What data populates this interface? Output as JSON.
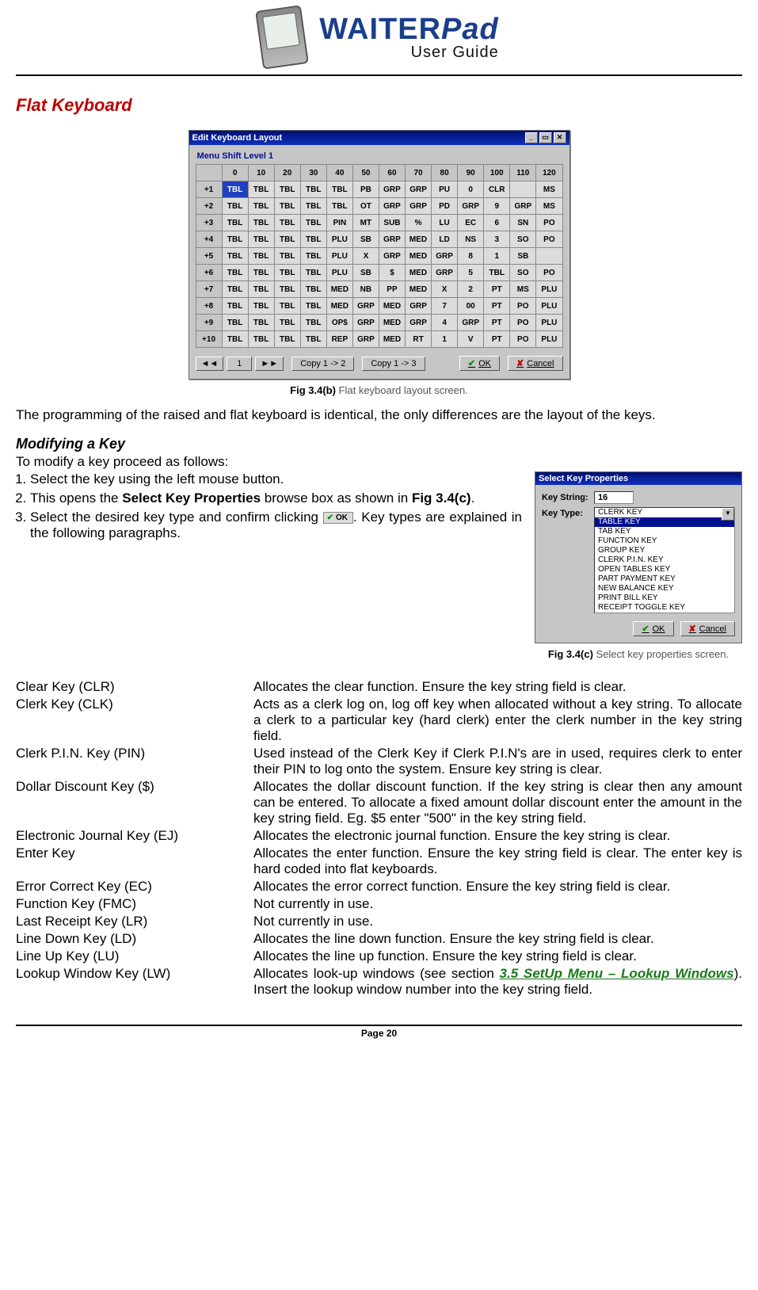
{
  "header": {
    "brand": "WAITER",
    "brand_suffix": "Pad",
    "subtitle": "User Guide"
  },
  "section_title": "Flat Keyboard",
  "kbd_window": {
    "title": "Edit Keyboard Layout",
    "shift_label": "Menu Shift Level 1",
    "col_headers": [
      "0",
      "10",
      "20",
      "30",
      "40",
      "50",
      "60",
      "70",
      "80",
      "90",
      "100",
      "110",
      "120"
    ],
    "row_headers": [
      "+1",
      "+2",
      "+3",
      "+4",
      "+5",
      "+6",
      "+7",
      "+8",
      "+9",
      "+10"
    ],
    "cells": [
      [
        "TBL",
        "TBL",
        "TBL",
        "TBL",
        "TBL",
        "PB",
        "GRP",
        "GRP",
        "PU",
        "0",
        "CLR",
        "",
        "MS"
      ],
      [
        "TBL",
        "TBL",
        "TBL",
        "TBL",
        "TBL",
        "OT",
        "GRP",
        "GRP",
        "PD",
        "GRP",
        "9",
        "GRP",
        "MS"
      ],
      [
        "TBL",
        "TBL",
        "TBL",
        "TBL",
        "PIN",
        "MT",
        "SUB",
        "%",
        "LU",
        "EC",
        "6",
        "SN",
        "PO"
      ],
      [
        "TBL",
        "TBL",
        "TBL",
        "TBL",
        "PLU",
        "SB",
        "GRP",
        "MED",
        "LD",
        "NS",
        "3",
        "SO",
        "PO"
      ],
      [
        "TBL",
        "TBL",
        "TBL",
        "TBL",
        "PLU",
        "X",
        "GRP",
        "MED",
        "GRP",
        "8",
        "1",
        "SB",
        ""
      ],
      [
        "TBL",
        "TBL",
        "TBL",
        "TBL",
        "PLU",
        "SB",
        "$",
        "MED",
        "GRP",
        "5",
        "TBL",
        "SO",
        "PO"
      ],
      [
        "TBL",
        "TBL",
        "TBL",
        "TBL",
        "MED",
        "NB",
        "PP",
        "MED",
        "X",
        "2",
        "PT",
        "MS",
        "PLU"
      ],
      [
        "TBL",
        "TBL",
        "TBL",
        "TBL",
        "MED",
        "GRP",
        "MED",
        "GRP",
        "7",
        "00",
        "PT",
        "PO",
        "PLU"
      ],
      [
        "TBL",
        "TBL",
        "TBL",
        "TBL",
        "OP$",
        "GRP",
        "MED",
        "GRP",
        "4",
        "GRP",
        "PT",
        "PO",
        "PLU"
      ],
      [
        "TBL",
        "TBL",
        "TBL",
        "TBL",
        "REP",
        "GRP",
        "MED",
        "RT",
        "1",
        "V",
        "PT",
        "PO",
        "PLU"
      ]
    ],
    "pager_value": "1",
    "copy12": "Copy 1 -> 2",
    "copy13": "Copy 1 -> 3",
    "ok": "OK",
    "cancel": "Cancel"
  },
  "fig_b_label": "Fig 3.4(b)",
  "fig_b_text": " Flat keyboard layout screen.",
  "para1": "The programming of the raised and flat keyboard is identical, the only differences are the layout of the keys.",
  "subheading": "Modifying a Key",
  "intro": "To modify a key proceed as follows:",
  "steps": {
    "s1": "Select the key using the left mouse button.",
    "s2a": "This opens the ",
    "s2b": "Select Key Properties",
    "s2c": " browse box as shown in ",
    "s2_figref": "Fig 3.4(c)",
    "s2d": ".",
    "s3a": "Select the desired key type and confirm clicking ",
    "s3_ok": "OK",
    "s3b": ". Key types are explained in the following paragraphs."
  },
  "props_window": {
    "title": "Select Key Properties",
    "keystring_label": "Key String:",
    "keystring_value": "16",
    "keytype_label": "Key Type:",
    "options": [
      "CLERK KEY",
      "TABLE KEY",
      "TAB KEY",
      "FUNCTION KEY",
      "GROUP KEY",
      "CLERK P.I.N. KEY",
      "OPEN TABLES KEY",
      "PART PAYMENT KEY",
      "NEW BALANCE KEY",
      "PRINT BILL KEY",
      "RECEIPT TOGGLE KEY"
    ],
    "selected_index": 1,
    "ok": "OK",
    "cancel": "Cancel"
  },
  "fig_c_label": "Fig 3.4(c)",
  "fig_c_text": " Select key properties screen.",
  "definitions": [
    {
      "term": "Clear Key (CLR)",
      "desc": "Allocates the clear function. Ensure the key string field is clear."
    },
    {
      "term": "Clerk Key (CLK)",
      "desc": "Acts as a clerk log on, log off key when allocated without a key string. To allocate a clerk to a particular key (hard clerk) enter the clerk number in the key string field."
    },
    {
      "term": "Clerk P.I.N. Key (PIN)",
      "desc": "Used instead of the Clerk Key if Clerk P.I.N's are in used, requires clerk to enter their PIN to log onto the system. Ensure key string is clear."
    },
    {
      "term": "Dollar Discount Key ($)",
      "desc": "Allocates the dollar discount function. If the key string is clear then any amount can be entered. To allocate a fixed amount dollar discount enter the amount in the key string field. Eg. $5 enter \"500\" in the key string field."
    },
    {
      "term": "Electronic Journal Key (EJ)",
      "desc": "Allocates the electronic journal function. Ensure the key string is clear."
    },
    {
      "term": "Enter Key",
      "desc": "Allocates the enter function. Ensure the key string field is clear. The enter key is hard coded into flat keyboards."
    },
    {
      "term": "Error Correct Key (EC)",
      "desc": "Allocates the error correct function. Ensure the key string field is clear."
    },
    {
      "term": "Function Key (FMC)",
      "desc": "Not currently in use."
    },
    {
      "term": "Last Receipt Key (LR)",
      "desc": "Not currently in use."
    },
    {
      "term": "Line Down Key (LD)",
      "desc": "Allocates the line down function. Ensure the key string field is clear."
    },
    {
      "term": "Line Up Key (LU)",
      "desc": "Allocates the line up function. Ensure the key string field is clear."
    }
  ],
  "lookup": {
    "term": "Lookup Window Key (LW)",
    "pre": "Allocates look-up windows (see section ",
    "link": "3.5 SetUp Menu – Lookup Windows",
    "post": "). Insert the lookup window number into the key string field."
  },
  "page_number": "Page 20"
}
